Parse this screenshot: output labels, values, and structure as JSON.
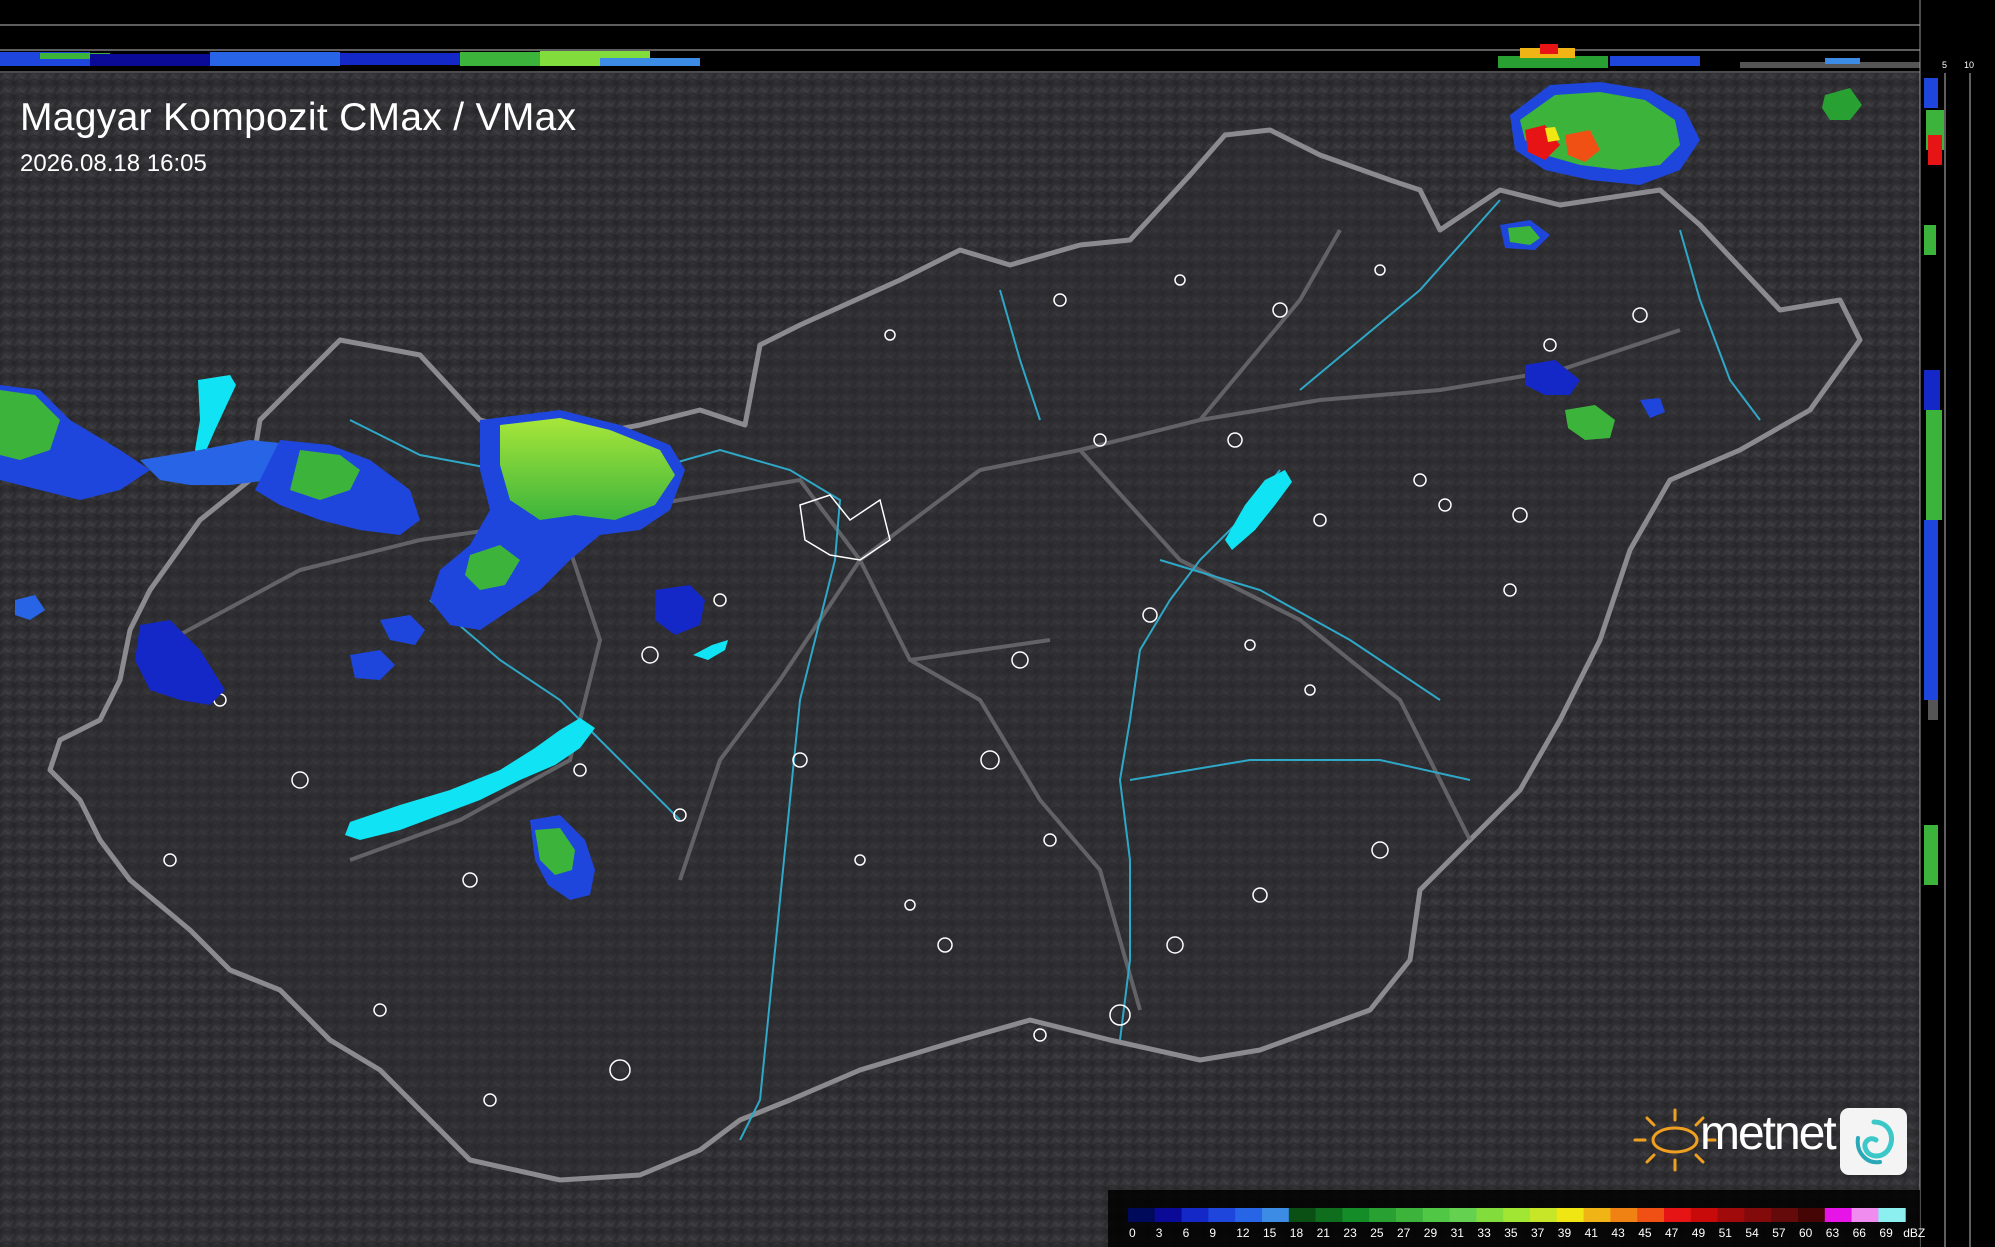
{
  "title": "Magyar Kompozit CMax / VMax",
  "timestamp": "2026.08.18 16:05",
  "brand": {
    "name": "metnet"
  },
  "profile_axis": {
    "top_ticks": [
      "10",
      "5"
    ],
    "side_ticks": [
      "5",
      "10"
    ]
  },
  "legend": {
    "unit": "dBZ",
    "values": [
      "0",
      "3",
      "6",
      "9",
      "12",
      "15",
      "18",
      "21",
      "23",
      "25",
      "27",
      "29",
      "31",
      "33",
      "35",
      "37",
      "39",
      "41",
      "43",
      "45",
      "47",
      "49",
      "51",
      "54",
      "57",
      "60",
      "63",
      "66",
      "69"
    ],
    "colors": [
      "#000a5a",
      "#0a0a96",
      "#1428c8",
      "#1e46dc",
      "#2864e6",
      "#3c8ce6",
      "#0a5014",
      "#0f6e1e",
      "#148c28",
      "#28a032",
      "#3cb43c",
      "#50c846",
      "#64d250",
      "#82dc3c",
      "#a0e632",
      "#c8e628",
      "#f0e614",
      "#f0b414",
      "#f08214",
      "#f05014",
      "#e61414",
      "#c80a0a",
      "#a00a0a",
      "#820a0a",
      "#640a0a",
      "#460505",
      "#e614e6",
      "#f08cf0",
      "#8cf0f0"
    ]
  }
}
